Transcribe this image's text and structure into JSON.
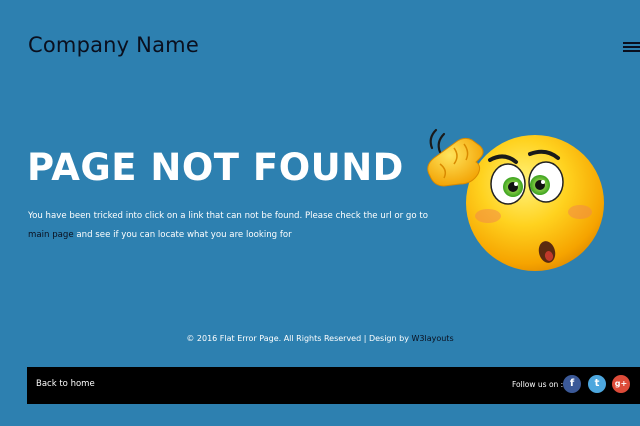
{
  "header": {
    "brand": "Company Name",
    "menu_icon": "hamburger-menu-icon"
  },
  "main": {
    "heading": "PAGE NOT FOUND",
    "message_before_link": "You have been tricked into click on a link that can not be found. Please check the url or go to",
    "link_text": "main page",
    "message_after_link": " and see if you can locate what you are looking for",
    "illustration_icon": "confused-emoji-icon"
  },
  "copyright": {
    "text": "© 2016 Flat Error Page. All Rights Reserved | Design by ",
    "link": "W3layouts"
  },
  "footer": {
    "back_home": "Back to home",
    "follow_label": "Follow us on :",
    "social": [
      {
        "icon": "facebook-icon",
        "glyph": "f",
        "color": "#3b5998"
      },
      {
        "icon": "twitter-icon",
        "glyph": "t",
        "color": "#4da7de"
      },
      {
        "icon": "google-plus-icon",
        "glyph": "g+",
        "color": "#dd4b39"
      }
    ]
  },
  "colors": {
    "background": "#2d80b0",
    "dark_text": "#0a0f1e",
    "footer_bar": "#000000"
  }
}
